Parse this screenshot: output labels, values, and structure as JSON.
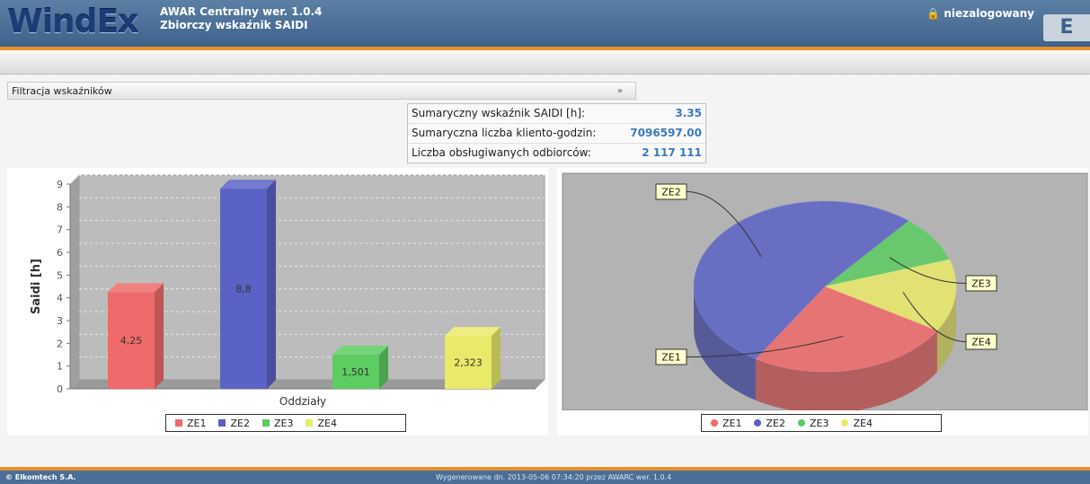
{
  "header": {
    "logo": "WindEx",
    "title_line1": "AWAR Centralny wer. 1.0.4",
    "title_line2": "Zbiorczy wskaźnik SAIDI",
    "user": "niezalogowany"
  },
  "filter": {
    "label": "Filtracja wskaźników",
    "expand": "»"
  },
  "summary": [
    {
      "label": "Sumaryczny wskaźnik SAIDI [h]:",
      "value": "3.35"
    },
    {
      "label": "Sumaryczna liczba kliento-godzin:",
      "value": "7096597.00"
    },
    {
      "label": "Liczba obsługiwanych odbiorców:",
      "value": "2 117 111"
    }
  ],
  "chart_data": [
    {
      "type": "bar",
      "categories": [
        "ZE1",
        "ZE2",
        "ZE3",
        "ZE4"
      ],
      "values": [
        4.25,
        8.8,
        1.501,
        2.323
      ],
      "data_labels": [
        "4,25",
        "8,8",
        "1,501",
        "2,323"
      ],
      "colors": [
        "#ef6a6a",
        "#5b62c5",
        "#5dcc61",
        "#eaea6a"
      ],
      "xlabel": "Oddziały",
      "ylabel": "Saidi [h]",
      "ylim": [
        0,
        9
      ],
      "yticks": [
        0,
        1,
        2,
        3,
        4,
        5,
        6,
        7,
        8,
        9
      ],
      "grid": true,
      "legend": "bottom"
    },
    {
      "type": "pie",
      "labels": [
        "ZE1",
        "ZE2",
        "ZE3",
        "ZE4"
      ],
      "values": [
        4.25,
        8.8,
        1.501,
        2.323
      ],
      "colors": [
        "#ef6a6a",
        "#5b62c5",
        "#5dcc61",
        "#eaea6a"
      ],
      "legend": "bottom"
    }
  ],
  "footer": {
    "copyright": "© Elkomtech S.A.",
    "generated": "Wygenerowane dn. 2013-05-06 07:34:20 przez AWARC wer. 1.0.4"
  }
}
